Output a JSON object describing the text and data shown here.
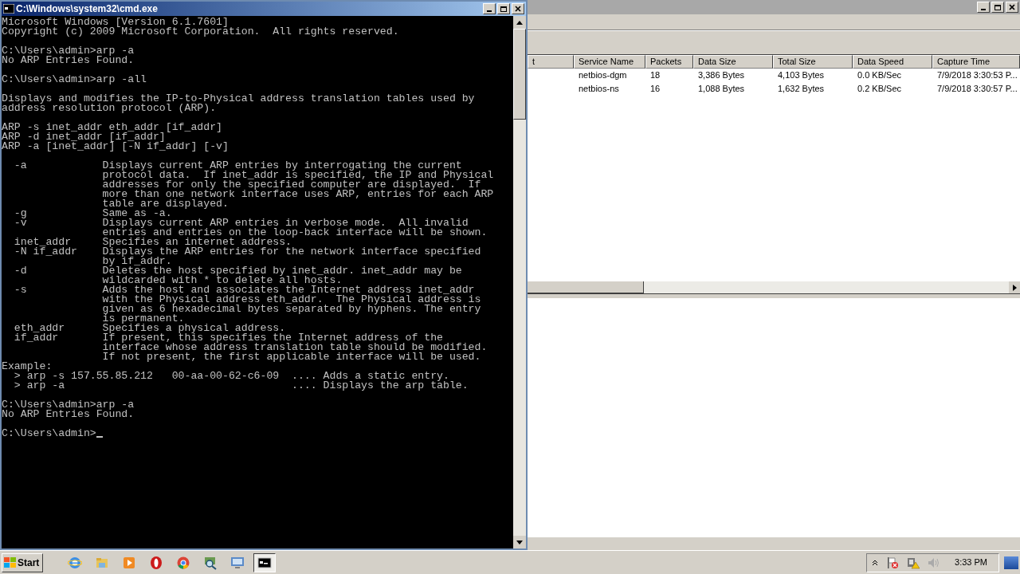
{
  "console_window": {
    "title": "C:\\Windows\\system32\\cmd.exe",
    "blocks": [
      [
        "Microsoft Windows [Version 6.1.7601]",
        "Copyright (c) 2009 Microsoft Corporation.  All rights reserved."
      ],
      [
        "C:\\Users\\admin>arp -a",
        "No ARP Entries Found."
      ],
      [
        "C:\\Users\\admin>arp -all"
      ],
      [
        "Displays and modifies the IP-to-Physical address translation tables used by",
        "address resolution protocol (ARP)."
      ],
      [
        "ARP -s inet_addr eth_addr [if_addr]",
        "ARP -d inet_addr [if_addr]",
        "ARP -a [inet_addr] [-N if_addr] [-v]"
      ],
      [
        "  -a            Displays current ARP entries by interrogating the current",
        "                protocol data.  If inet_addr is specified, the IP and Physical",
        "                addresses for only the specified computer are displayed.  If",
        "                more than one network interface uses ARP, entries for each ARP",
        "                table are displayed.",
        "  -g            Same as -a.",
        "  -v            Displays current ARP entries in verbose mode.  All invalid",
        "                entries and entries on the loop-back interface will be shown.",
        "  inet_addr     Specifies an internet address.",
        "  -N if_addr    Displays the ARP entries for the network interface specified",
        "                by if_addr.",
        "  -d            Deletes the host specified by inet_addr. inet_addr may be",
        "                wildcarded with * to delete all hosts.",
        "  -s            Adds the host and associates the Internet address inet_addr",
        "                with the Physical address eth_addr.  The Physical address is",
        "                given as 6 hexadecimal bytes separated by hyphens. The entry",
        "                is permanent.",
        "  eth_addr      Specifies a physical address.",
        "  if_addr       If present, this specifies the Internet address of the",
        "                interface whose address translation table should be modified.",
        "                If not present, the first applicable interface will be used.",
        "Example:",
        "  > arp -s 157.55.85.212   00-aa-00-62-c6-09  .... Adds a static entry.",
        "  > arp -a                                    .... Displays the arp table."
      ],
      [
        "C:\\Users\\admin>arp -a",
        "No ARP Entries Found."
      ],
      [
        "C:\\Users\\admin>"
      ]
    ]
  },
  "capture_window": {
    "table": {
      "columns": [
        "t",
        "Service Name",
        "Packets",
        "Data Size",
        "Total Size",
        "Data Speed",
        "Capture Time"
      ],
      "rows": [
        [
          "",
          "netbios-dgm",
          "18",
          "3,386 Bytes",
          "4,103 Bytes",
          "0.0 KB/Sec",
          "7/9/2018 3:30:53 P..."
        ],
        [
          "",
          "netbios-ns",
          "16",
          "1,088 Bytes",
          "1,632 Bytes",
          "0.2 KB/Sec",
          "7/9/2018 3:30:57 P..."
        ]
      ]
    }
  },
  "taskbar": {
    "start": "Start",
    "items": [
      {
        "kind": "ie",
        "selected": false
      },
      {
        "kind": "folder",
        "selected": false
      },
      {
        "kind": "media",
        "selected": false
      },
      {
        "kind": "opera",
        "selected": false
      },
      {
        "kind": "chrome",
        "selected": false
      },
      {
        "kind": "sniffer",
        "selected": false
      },
      {
        "kind": "monitor",
        "selected": false
      },
      {
        "kind": "cmd",
        "selected": true
      }
    ],
    "clock": "3:33 PM"
  }
}
